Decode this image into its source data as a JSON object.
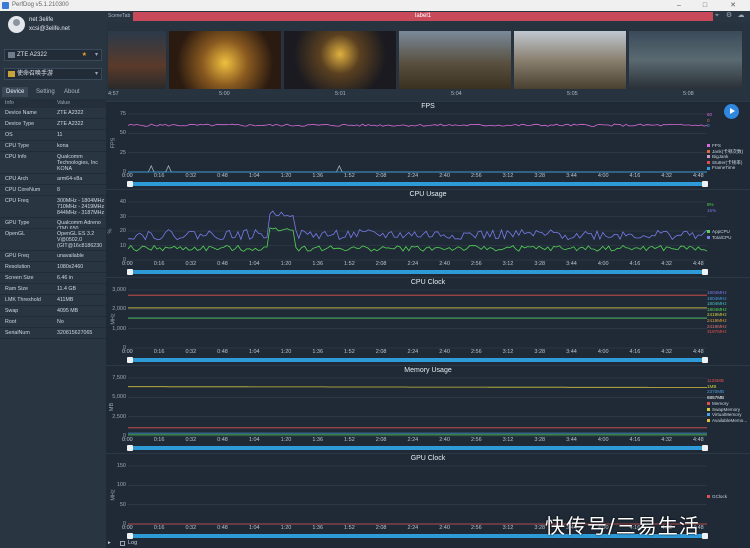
{
  "window": {
    "title": "PerfDog v5.1.210300"
  },
  "profile": {
    "name": "net 3elife",
    "email": "xcsi@3elife.net"
  },
  "device_select": "ZTE A2322",
  "app_select": "使命召唤手游",
  "tabs": [
    "Device",
    "Setting",
    "About"
  ],
  "info_headers": [
    "Info",
    "Value"
  ],
  "info_rows": [
    [
      "Device Name",
      "ZTE A2322"
    ],
    [
      "Device Type",
      "ZTE A2322"
    ],
    [
      "OS",
      "11"
    ],
    [
      "CPU Type",
      "kona"
    ],
    [
      "CPU Info",
      "Qualcomm Technologies, Inc KONA"
    ],
    [
      "CPU Arch",
      "arm64-v8a"
    ],
    [
      "CPU CoreNum",
      "8"
    ],
    [
      "CPU Freq",
      "300MHz - 1804MHz 710MHz - 2419MHz 844MHz - 3187MHz"
    ],
    [
      "GPU Type",
      "Qualcomm Adreno (TM) 650"
    ],
    [
      "OpenGL",
      "OpenGL ES 3.2 V@0502.0 (GIT@16c8186230"
    ],
    [
      "GPU Freq",
      "unavailable"
    ],
    [
      "Resolution",
      "1080x2460"
    ],
    [
      "Screen Size",
      "6.46 in"
    ],
    [
      "Ram Size",
      "11.4 GB"
    ],
    [
      "LMK Threshold",
      "411MB"
    ],
    [
      "Swap",
      "4095 MB"
    ],
    [
      "Root",
      "No"
    ],
    [
      "SerialNum",
      "320815627065"
    ]
  ],
  "scene": {
    "tab_label": "SceneTab",
    "label": "label1"
  },
  "strip_times": [
    "4:57",
    "5:00",
    "5:01",
    "5:04",
    "5:05",
    "5:08"
  ],
  "x_ticks": [
    "0:00",
    "0:16",
    "0:32",
    "0:48",
    "1:04",
    "1:20",
    "1:36",
    "1:52",
    "2:08",
    "2:24",
    "2:40",
    "2:56",
    "3:12",
    "3:28",
    "3:44",
    "4:00",
    "4:16",
    "4:32",
    "4:48"
  ],
  "panels": [
    {
      "title": "FPS",
      "ylabel": "FPS",
      "yticks": [
        "75",
        "50",
        "25",
        "0"
      ],
      "ymax": 75,
      "legend_values": [
        {
          "t": "60",
          "c": "#d86bd8"
        },
        {
          "t": "0",
          "c": "#c87a3a"
        },
        {
          "t": "0",
          "c": "#4a9de0"
        }
      ],
      "legend": [
        {
          "t": "FPS",
          "c": "#d86bd8"
        },
        {
          "t": "Jank(卡顿次数)",
          "c": "#e06a3a"
        },
        {
          "t": "BigJank",
          "c": "#c8a0c8"
        },
        {
          "t": "Stutter(卡顿率)",
          "c": "#e04a4a"
        },
        {
          "t": "FrameTime",
          "c": "#2fa0e0"
        }
      ]
    },
    {
      "title": "CPU Usage",
      "ylabel": "%",
      "yticks": [
        "40",
        "30",
        "20",
        "10",
        "0"
      ],
      "ymax": 40,
      "legend_values": [
        {
          "t": "8%",
          "c": "#55d455"
        },
        {
          "t": "16%",
          "c": "#7a7ae8"
        }
      ],
      "legend": [
        {
          "t": "AppCPU",
          "c": "#55d455"
        },
        {
          "t": "TotalCPU",
          "c": "#7a7ae8"
        }
      ]
    },
    {
      "title": "CPU Clock",
      "ylabel": "MHz",
      "yticks": [
        "3,000",
        "2,000",
        "1,000",
        "0"
      ],
      "ymax": 3500,
      "legend_values": [
        {
          "t": "1804MHz",
          "c": "#7a7ae8"
        },
        {
          "t": "1804MHz",
          "c": "#4a9de0"
        },
        {
          "t": "1804MHz",
          "c": "#4ac0c0"
        },
        {
          "t": "1804MHz",
          "c": "#55d455"
        },
        {
          "t": "2419MHz",
          "c": "#d0d040"
        },
        {
          "t": "2419MHz",
          "c": "#e0a040"
        },
        {
          "t": "2419MHz",
          "c": "#e07070"
        },
        {
          "t": "3187MHz",
          "c": "#e05050"
        }
      ],
      "legend": []
    },
    {
      "title": "Memory Usage",
      "ylabel": "MB",
      "yticks": [
        "7,500",
        "5,000",
        "2,500",
        "0"
      ],
      "ymax": 8000,
      "legend_values": [
        {
          "t": "1126MB",
          "c": "#e05050"
        },
        {
          "t": "1MB",
          "c": "#d0d040"
        },
        {
          "t": "2370MB",
          "c": "#4a9de0"
        },
        {
          "t": "6857MB",
          "c": "#ffffff"
        }
      ],
      "legend": [
        {
          "t": "Memory",
          "c": "#e05050"
        },
        {
          "t": "SwapMemory",
          "c": "#d0d040"
        },
        {
          "t": "VirtualMemory",
          "c": "#4a9de0"
        },
        {
          "t": "AvailableMemo...",
          "c": "#e0c040"
        }
      ]
    },
    {
      "title": "GPU Clock",
      "ylabel": "MHz",
      "yticks": [
        "150",
        "100",
        "50",
        "0"
      ],
      "ymax": 150,
      "legend_values": [],
      "legend": [
        {
          "t": "GClock",
          "c": "#e05050"
        }
      ]
    }
  ],
  "footer": {
    "log": "Log"
  },
  "watermark": "快传号/三易生活"
}
